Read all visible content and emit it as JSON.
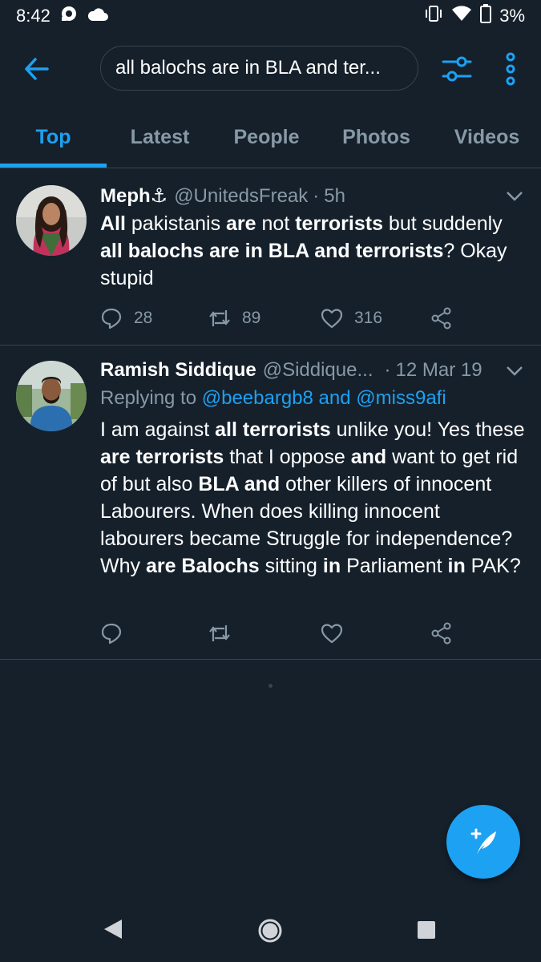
{
  "status_bar": {
    "time": "8:42",
    "battery": "3%",
    "icons": [
      "notification-icon",
      "cloud-icon",
      "vibrate-icon",
      "wifi-icon",
      "battery-icon"
    ]
  },
  "search": {
    "query": "all balochs are in BLA and ter..."
  },
  "tabs": [
    {
      "label": "Top",
      "active": true
    },
    {
      "label": "Latest",
      "active": false
    },
    {
      "label": "People",
      "active": false
    },
    {
      "label": "Photos",
      "active": false
    },
    {
      "label": "Videos",
      "active": false
    }
  ],
  "tweets": [
    {
      "name": "Meph⚓",
      "handle": "@UnitedsFreak",
      "separator": "·",
      "time": "5h",
      "body_segments": [
        {
          "text": "All",
          "bold": true
        },
        {
          "text": " pakistanis ",
          "bold": false
        },
        {
          "text": "are",
          "bold": true
        },
        {
          "text": " not ",
          "bold": false
        },
        {
          "text": "terrorists",
          "bold": true
        },
        {
          "text": " but suddenly ",
          "bold": false
        },
        {
          "text": "all balochs are in BLA and terrorists",
          "bold": true
        },
        {
          "text": "? Okay stupid",
          "bold": false
        }
      ],
      "replies": "28",
      "retweets": "89",
      "likes": "316"
    },
    {
      "name": "Ramish Siddique",
      "handle": "@Siddique...",
      "separator": "·",
      "time": "12 Mar 19",
      "reply_prefix": "Replying to ",
      "reply_user1": "@beebargb8",
      "reply_and": " and ",
      "reply_user2": "@miss9afi",
      "body_segments": [
        {
          "text": "I am against ",
          "bold": false
        },
        {
          "text": "all terrorists",
          "bold": true
        },
        {
          "text": " unlike you! Yes these ",
          "bold": false
        },
        {
          "text": "are terrorists",
          "bold": true
        },
        {
          "text": " that I oppose ",
          "bold": false
        },
        {
          "text": "and",
          "bold": true
        },
        {
          "text": " want to get rid of but also ",
          "bold": false
        },
        {
          "text": "BLA and",
          "bold": true
        },
        {
          "text": " other killers of innocent Labourers. When does killing innocent labourers became Struggle for independence? Why ",
          "bold": false
        },
        {
          "text": "are Balochs",
          "bold": true
        },
        {
          "text": " sitting ",
          "bold": false
        },
        {
          "text": "in",
          "bold": true
        },
        {
          "text": " Parliament ",
          "bold": false
        },
        {
          "text": "in",
          "bold": true
        },
        {
          "text": " PAK?",
          "bold": false
        }
      ]
    }
  ],
  "colors": {
    "background": "#15202b",
    "accent": "#1da1f2",
    "secondary_text": "#8899a6",
    "divider": "#38444d"
  }
}
